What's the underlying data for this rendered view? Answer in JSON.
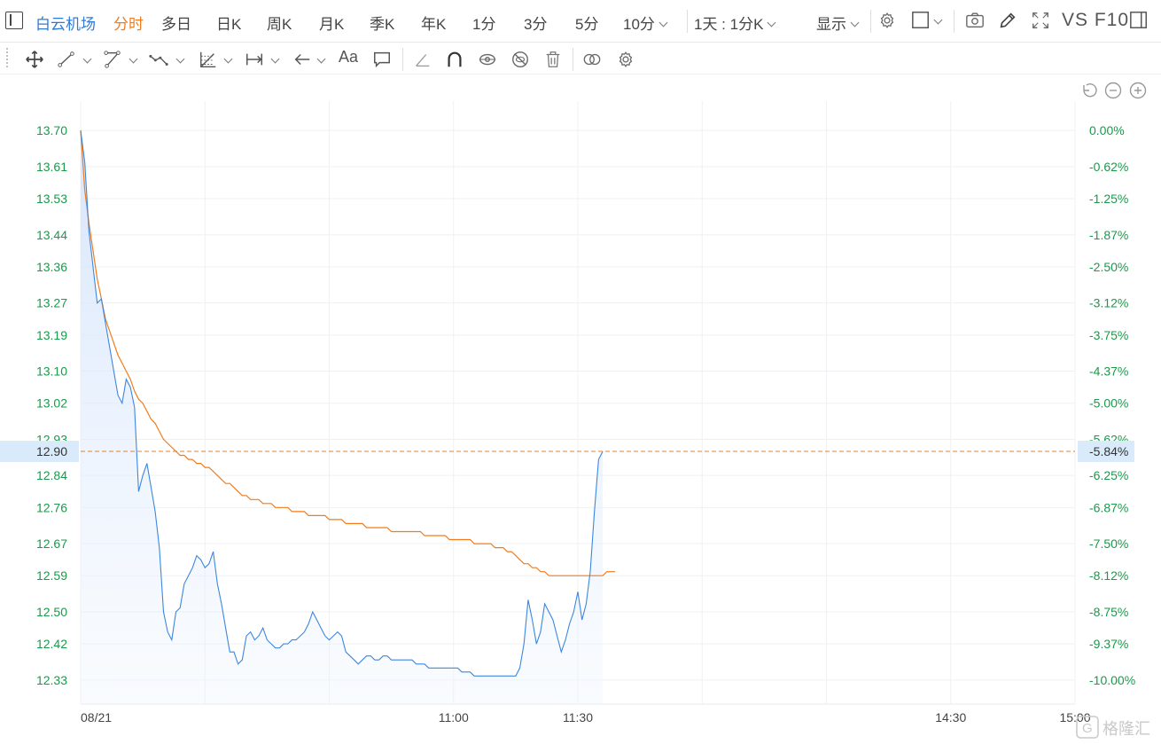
{
  "header": {
    "stock_name": "白云机场",
    "tabs": [
      {
        "label": "分时",
        "active": true
      },
      {
        "label": "多日"
      },
      {
        "label": "日K"
      },
      {
        "label": "周K"
      },
      {
        "label": "月K"
      },
      {
        "label": "季K"
      },
      {
        "label": "年K"
      },
      {
        "label": "1分"
      },
      {
        "label": "3分"
      },
      {
        "label": "5分"
      }
    ],
    "interval_select": "10分",
    "range_select": "1天 : 1分K",
    "display_select": "显示",
    "vs_f10": "VS F10",
    "icons": [
      "sidebar-toggle-icon",
      "gear-icon",
      "square-icon",
      "camera-icon",
      "pencil-icon",
      "fullscreen-icon",
      "panel-icon"
    ]
  },
  "draw_toolbar": {
    "tools": [
      "move-icon",
      "line-segment-icon",
      "polyline-icon",
      "wave-icon",
      "fibonacci-icon",
      "measure-icon",
      "arrow-left-icon",
      "text-tool-icon",
      "comment-icon",
      "eraser-line-icon",
      "magnet-icon",
      "eye-toggle-icon",
      "hide-icon",
      "trash-icon",
      "link-icon",
      "settings-icon"
    ],
    "text_tool_label": "Aa"
  },
  "chart_controls": [
    "undo-icon",
    "zoom-out-icon",
    "zoom-in-icon"
  ],
  "watermark": "格隆汇",
  "chart_data": {
    "type": "line",
    "title": "",
    "xlabel": "",
    "ylabel": "",
    "prev_close": 13.7,
    "ylim": [
      12.27,
      13.76
    ],
    "y_ticks": [
      "13.70",
      "13.61",
      "13.53",
      "13.44",
      "13.36",
      "13.27",
      "13.19",
      "13.10",
      "13.02",
      "12.93",
      "12.84",
      "12.76",
      "12.67",
      "12.59",
      "12.50",
      "12.42",
      "12.33"
    ],
    "pct_ticks": [
      "0.00%",
      "-0.62%",
      "-1.25%",
      "-1.87%",
      "-2.50%",
      "-3.12%",
      "-3.75%",
      "-4.37%",
      "-5.00%",
      "-5.62%",
      "-6.25%",
      "-6.87%",
      "-7.50%",
      "-8.12%",
      "-8.75%",
      "-9.37%",
      "-10.00%"
    ],
    "x_labels": [
      {
        "label": "08/21",
        "min": 0
      },
      {
        "label": "11:00",
        "min": 90
      },
      {
        "label": "11:30",
        "min": 120
      },
      {
        "label": "14:30",
        "min": 210
      },
      {
        "label": "15:00",
        "min": 240
      }
    ],
    "x_grid_minutes": [
      0,
      30,
      60,
      90,
      120,
      150,
      180,
      210,
      240
    ],
    "x_total_minutes": 240,
    "crosshair": {
      "price": "12.90",
      "pct": "-5.84%"
    },
    "series": [
      {
        "key": "price",
        "color": "#3c87e0",
        "values": [
          13.7,
          13.62,
          13.45,
          13.36,
          13.27,
          13.28,
          13.22,
          13.16,
          13.1,
          13.04,
          13.02,
          13.08,
          13.06,
          13.01,
          12.8,
          12.84,
          12.87,
          12.81,
          12.75,
          12.66,
          12.5,
          12.45,
          12.43,
          12.5,
          12.51,
          12.57,
          12.59,
          12.61,
          12.64,
          12.63,
          12.61,
          12.62,
          12.65,
          12.57,
          12.52,
          12.46,
          12.4,
          12.4,
          12.37,
          12.38,
          12.44,
          12.45,
          12.43,
          12.44,
          12.46,
          12.43,
          12.42,
          12.41,
          12.41,
          12.42,
          12.42,
          12.43,
          12.43,
          12.44,
          12.45,
          12.47,
          12.5,
          12.48,
          12.46,
          12.44,
          12.43,
          12.44,
          12.45,
          12.44,
          12.4,
          12.39,
          12.38,
          12.37,
          12.38,
          12.39,
          12.39,
          12.38,
          12.38,
          12.39,
          12.39,
          12.38,
          12.38,
          12.38,
          12.38,
          12.38,
          12.38,
          12.37,
          12.37,
          12.37,
          12.36,
          12.36,
          12.36,
          12.36,
          12.36,
          12.36,
          12.36,
          12.36,
          12.35,
          12.35,
          12.35,
          12.34,
          12.34,
          12.34,
          12.34,
          12.34,
          12.34,
          12.34,
          12.34,
          12.34,
          12.34,
          12.34,
          12.36,
          12.42,
          12.53,
          12.48,
          12.42,
          12.45,
          12.52,
          12.5,
          12.48,
          12.44,
          12.4,
          12.43,
          12.47,
          12.5,
          12.55,
          12.48,
          12.52,
          12.6,
          12.75,
          12.88,
          12.9
        ]
      },
      {
        "key": "avg",
        "color": "#f07c1e",
        "values": [
          13.7,
          13.55,
          13.47,
          13.4,
          13.33,
          13.28,
          13.23,
          13.2,
          13.17,
          13.14,
          13.12,
          13.1,
          13.08,
          13.05,
          13.03,
          13.02,
          13.0,
          12.98,
          12.97,
          12.95,
          12.93,
          12.92,
          12.91,
          12.9,
          12.89,
          12.89,
          12.88,
          12.88,
          12.87,
          12.87,
          12.86,
          12.86,
          12.85,
          12.84,
          12.83,
          12.82,
          12.82,
          12.81,
          12.8,
          12.79,
          12.79,
          12.78,
          12.78,
          12.78,
          12.77,
          12.77,
          12.77,
          12.76,
          12.76,
          12.76,
          12.76,
          12.75,
          12.75,
          12.75,
          12.75,
          12.74,
          12.74,
          12.74,
          12.74,
          12.74,
          12.73,
          12.73,
          12.73,
          12.73,
          12.72,
          12.72,
          12.72,
          12.72,
          12.72,
          12.71,
          12.71,
          12.71,
          12.71,
          12.71,
          12.71,
          12.7,
          12.7,
          12.7,
          12.7,
          12.7,
          12.7,
          12.7,
          12.7,
          12.69,
          12.69,
          12.69,
          12.69,
          12.69,
          12.69,
          12.68,
          12.68,
          12.68,
          12.68,
          12.68,
          12.68,
          12.67,
          12.67,
          12.67,
          12.67,
          12.67,
          12.66,
          12.66,
          12.66,
          12.65,
          12.65,
          12.64,
          12.63,
          12.62,
          12.62,
          12.61,
          12.61,
          12.6,
          12.6,
          12.59,
          12.59,
          12.59,
          12.59,
          12.59,
          12.59,
          12.59,
          12.59,
          12.59,
          12.59,
          12.59,
          12.59,
          12.59,
          12.59,
          12.6,
          12.6,
          12.6
        ]
      }
    ]
  }
}
